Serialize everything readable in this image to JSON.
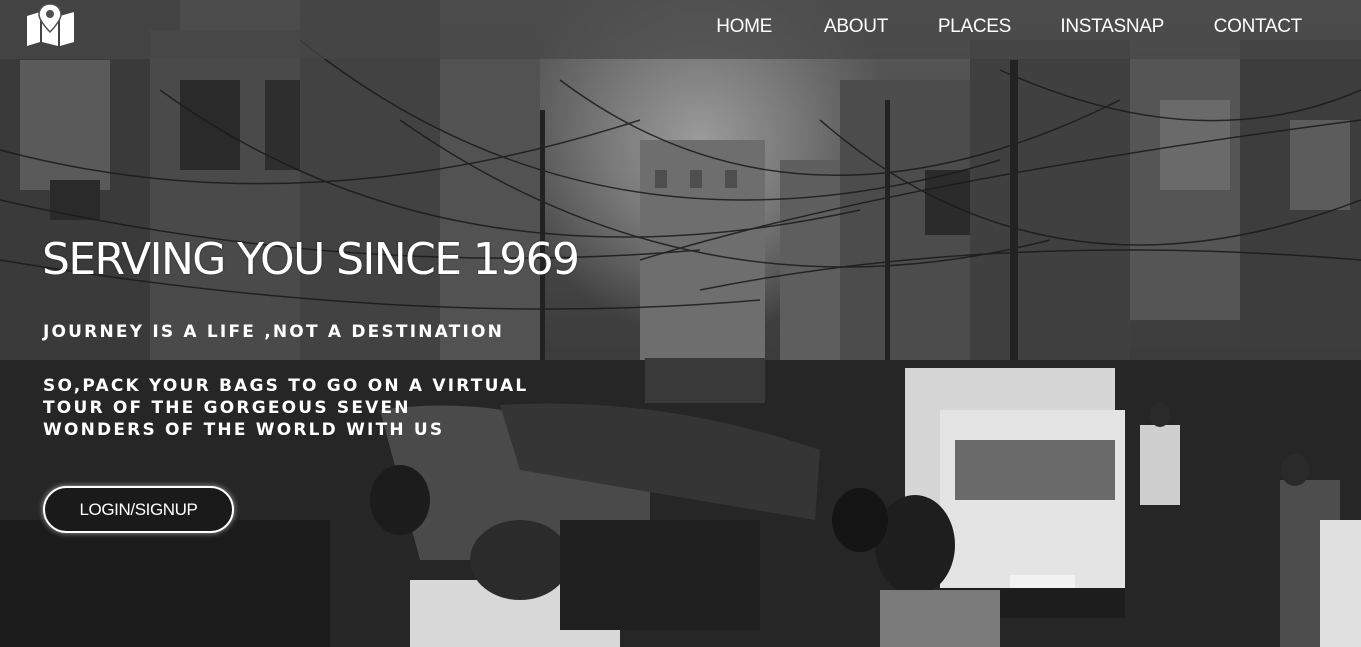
{
  "nav": {
    "logo_icon": "map-marker-map-icon",
    "links": [
      {
        "label": "HOME"
      },
      {
        "label": "ABOUT"
      },
      {
        "label": "PLACES"
      },
      {
        "label": "INSTASNAP"
      },
      {
        "label": "CONTACT"
      }
    ]
  },
  "hero": {
    "title": "SERVING YOU SINCE 1969",
    "tagline": "JOURNEY IS A LIFE ,NOT A DESTINATION",
    "description_lines": [
      "SO,PACK YOUR BAGS TO GO ON A VIRTUAL",
      "TOUR OF THE GORGEOUS SEVEN",
      "WONDERS OF THE WORLD WITH US"
    ],
    "cta_label": "LOGIN/SIGNUP",
    "background": "grayscale-street-photo"
  },
  "colors": {
    "text": "#ffffff",
    "navbar": "#464646",
    "button_bg": "#1a1a1a"
  }
}
